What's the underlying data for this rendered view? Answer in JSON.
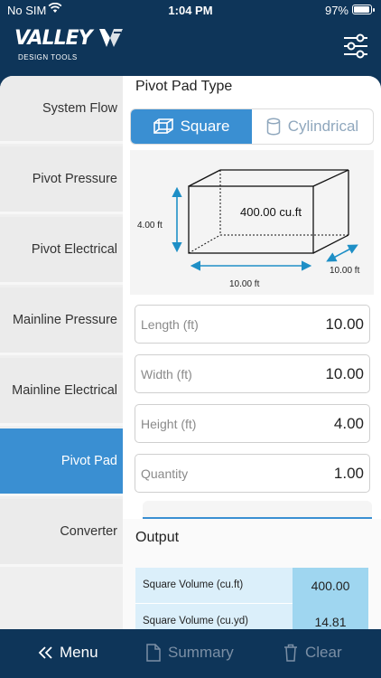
{
  "status": {
    "carrier": "No SIM",
    "time": "1:04 PM",
    "battery": "97%"
  },
  "app": {
    "brand": "VALLEY",
    "tagline": "DESIGN TOOLS"
  },
  "sidebar": {
    "items": [
      {
        "label": "System Flow"
      },
      {
        "label": "Pivot Pressure"
      },
      {
        "label": "Pivot Electrical"
      },
      {
        "label": "Mainline Pressure"
      },
      {
        "label": "Mainline Electrical"
      },
      {
        "label": "Pivot Pad",
        "active": true
      },
      {
        "label": "Converter"
      }
    ]
  },
  "main": {
    "title": "Pivot Pad Type",
    "types": {
      "square": "Square",
      "cylindrical": "Cylindrical",
      "selected": "Square"
    },
    "diagram": {
      "volume": "400.00 cu.ft",
      "height": "4.00 ft",
      "length": "10.00 ft",
      "width": "10.00 ft"
    },
    "fields": [
      {
        "label": "Length (ft)",
        "value": "10.00"
      },
      {
        "label": "Width (ft)",
        "value": "10.00"
      },
      {
        "label": "Height (ft)",
        "value": "4.00"
      },
      {
        "label": "Quantity",
        "value": "1.00"
      }
    ]
  },
  "output": {
    "title": "Output",
    "rows": [
      {
        "label": "Square Volume (cu.ft)",
        "value": "400.00"
      },
      {
        "label": "Square Volume (cu.yd)",
        "value": "14.81"
      }
    ]
  },
  "bottombar": {
    "menu": "Menu",
    "summary": "Summary",
    "clear": "Clear"
  },
  "colors": {
    "navy": "#0e3559",
    "accent": "#3a8fd2",
    "output_value_bg": "#9fd6f0"
  }
}
